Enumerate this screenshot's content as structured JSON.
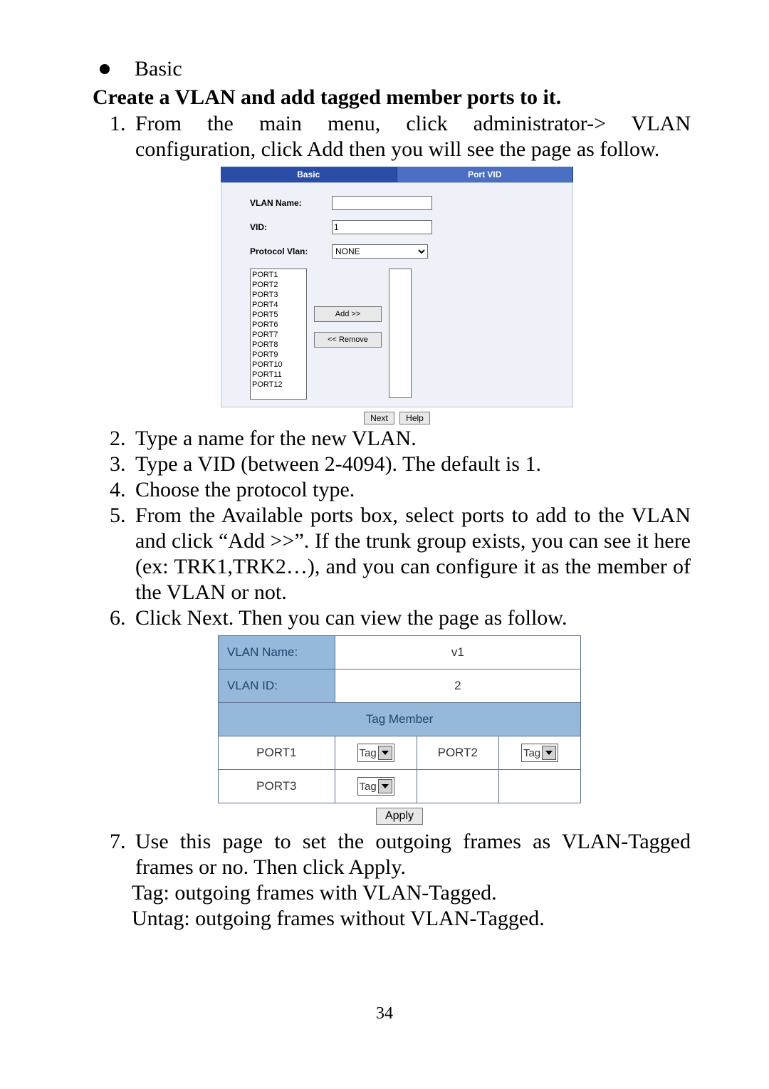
{
  "bullet_basic": "Basic",
  "heading": "Create a VLAN and add tagged member ports to it.",
  "steps": {
    "s1": "From the main menu, click administrator-> VLAN configuration, click Add then you will see the page as follow.",
    "s2": "Type a name for the new VLAN.",
    "s3": "Type a VID (between 2-4094). The default is 1.",
    "s4": "Choose the protocol type.",
    "s5": "From the Available ports box, select ports to add to the VLAN and click “Add >>”. If the trunk group exists, you can see it here (ex: TRK1,TRK2…), and you can configure it as the member of the VLAN or not.",
    "s6": "Click Next. Then you can view the page as follow.",
    "s7": "Use this page to set the outgoing frames as VLAN-Tagged frames or no. Then click Apply.",
    "s7a": "Tag: outgoing frames with VLAN-Tagged.",
    "s7b": "Untag: outgoing frames without VLAN-Tagged."
  },
  "fig1": {
    "tab_basic": "Basic",
    "tab_portvid": "Port VID",
    "label_vlanname": "VLAN Name:",
    "label_vid": "VID:",
    "vid_value": "1",
    "label_protocol": "Protocol Vlan:",
    "protocol_value": "NONE",
    "ports": [
      "PORT1",
      "PORT2",
      "PORT3",
      "PORT4",
      "PORT5",
      "PORT6",
      "PORT7",
      "PORT8",
      "PORT9",
      "PORT10",
      "PORT11",
      "PORT12"
    ],
    "btn_add": "Add   >>",
    "btn_remove": "<< Remove",
    "btn_next": "Next",
    "btn_help": "Help"
  },
  "fig2": {
    "label_vlanname": "VLAN Name:",
    "vlanname_value": "v1",
    "label_vlanid": "VLAN ID:",
    "vlanid_value": "2",
    "tag_member": "Tag Member",
    "port1": "PORT1",
    "port2": "PORT2",
    "port3": "PORT3",
    "tag": "Tag",
    "apply": "Apply"
  },
  "page_number": "34"
}
